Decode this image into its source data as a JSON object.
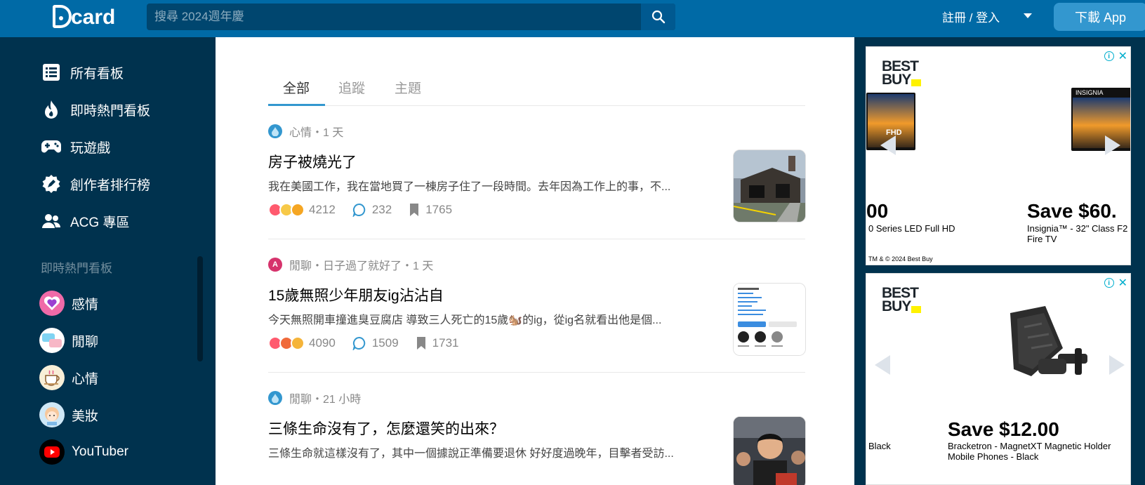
{
  "header": {
    "logo_text": "card",
    "search_placeholder": "搜尋 2024週年慶",
    "auth_label": "註冊 / 登入",
    "download_label": "下載 App"
  },
  "sidebar": {
    "nav": [
      {
        "label": "所有看板",
        "icon": "list-icon"
      },
      {
        "label": "即時熱門看板",
        "icon": "flame-icon"
      },
      {
        "label": "玩遊戲",
        "icon": "gamepad-icon"
      },
      {
        "label": "創作者排行榜",
        "icon": "pen-badge-icon"
      },
      {
        "label": "ACG 專區",
        "icon": "people-icon"
      }
    ],
    "section_title": "即時熱門看板",
    "forums": [
      {
        "label": "感情",
        "icon": "heart-forum-icon",
        "color": "#ee5a9e"
      },
      {
        "label": "閒聊",
        "icon": "chat-forum-icon",
        "color": "#7fd3f2"
      },
      {
        "label": "心情",
        "icon": "coffee-forum-icon",
        "color": "#f4e7c8"
      },
      {
        "label": "美妝",
        "icon": "girl-forum-icon",
        "color": "#ffd8b8"
      },
      {
        "label": "YouTuber",
        "icon": "youtube-forum-icon",
        "color": "#ff0000"
      }
    ]
  },
  "tabs": [
    {
      "label": "全部",
      "active": true
    },
    {
      "label": "追蹤",
      "active": false
    },
    {
      "label": "主題",
      "active": false
    }
  ],
  "posts": [
    {
      "meta": "心情・1 天",
      "title": "房子被燒光了",
      "excerpt": "我在美國工作，我在當地買了一棟房子住了一段時間。去年因為工作上的事，不...",
      "reactions": "4212",
      "comments": "232",
      "saves": "1765",
      "meta_icon": "drop-icon",
      "meta_icon_color": "#3397cf"
    },
    {
      "meta": "閒聊・日子過了就好了・1 天",
      "title": "15歲無照少年朋友ig沾沾自",
      "excerpt": "今天無照開車撞進臭豆腐店 導致三人死亡的15歲🐿️的ig，從ig名就看出他是個...",
      "reactions": "4090",
      "comments": "1509",
      "saves": "1731",
      "meta_icon": "avatar-a-icon",
      "meta_icon_letter": "A",
      "meta_icon_color": "#d6336c"
    },
    {
      "meta": "閒聊・21 小時",
      "title": "三條生命沒有了，怎麼還笑的出來？",
      "excerpt": "三條生命就這樣沒有了，其中一個據說正準備要退休 好好度過晚年，目擊者受訪...",
      "meta_icon": "drop-icon",
      "meta_icon_color": "#3397cf"
    }
  ],
  "ads": [
    {
      "brand_line1": "BEST",
      "brand_line2": "BUY",
      "tv_left_label": "FHD",
      "tv_right_label": "INSIGNIA",
      "price_left": "00",
      "desc_left": "0 Series LED Full HD",
      "price_right": "Save $60.",
      "desc_right_1": "Insignia™ - 32\" Class F2",
      "desc_right_2": "Fire TV",
      "footer": "TM & © 2024 Best Buy"
    },
    {
      "brand_line1": "BEST",
      "brand_line2": "BUY",
      "price": "Save $12.00",
      "desc_left": "Black",
      "desc_1": "Bracketron - MagnetXT Magnetic Holder",
      "desc_2": "Mobile Phones - Black"
    }
  ],
  "colors": {
    "header": "#006aa6",
    "sidebar": "#00324e",
    "accent": "#3397cf"
  }
}
